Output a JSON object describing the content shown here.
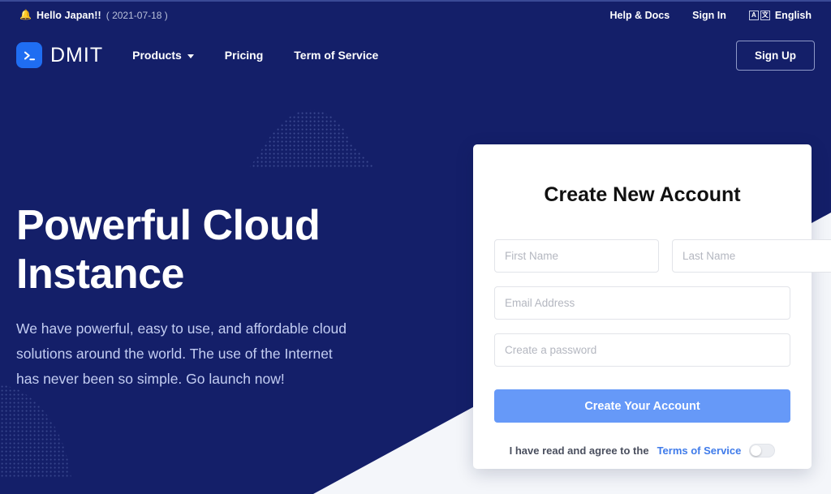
{
  "announcement": {
    "bell_icon": "bell-icon",
    "title": "Hello Japan!!",
    "date": "( 2021-07-18 )",
    "help_label": "Help & Docs",
    "signin_label": "Sign In",
    "language_label": "English",
    "translate_glyph_a": "A",
    "translate_glyph_b": "文"
  },
  "nav": {
    "brand_name": "DMIT",
    "brand_glyph": ">_",
    "links": [
      {
        "label": "Products",
        "has_chevron": true
      },
      {
        "label": "Pricing",
        "has_chevron": false
      },
      {
        "label": "Term of Service",
        "has_chevron": false
      }
    ],
    "signup_label": "Sign Up"
  },
  "hero": {
    "title": "Powerful Cloud Instance",
    "subtitle": "We have powerful, easy to use, and affordable cloud solutions around the world. The use of the Internet has never been so simple. Go launch now!"
  },
  "signup_card": {
    "title": "Create New Account",
    "first_name": {
      "value": "",
      "placeholder": "First Name"
    },
    "last_name": {
      "value": "",
      "placeholder": "Last Name"
    },
    "email": {
      "value": "",
      "placeholder": "Email Address"
    },
    "password": {
      "value": "",
      "placeholder": "Create a password"
    },
    "submit_label": "Create Your Account",
    "agree_text": "I have read and agree to the",
    "agree_link_label": "Terms of Service",
    "agree_toggle_state": "off"
  },
  "colors": {
    "navy": "#141f69",
    "wedge": "#f4f6fa",
    "brand_blue": "#1f6df2",
    "button_blue": "#6699f8",
    "link_blue": "#3f7bea",
    "subtitle_blue": "#c3cdf2"
  }
}
